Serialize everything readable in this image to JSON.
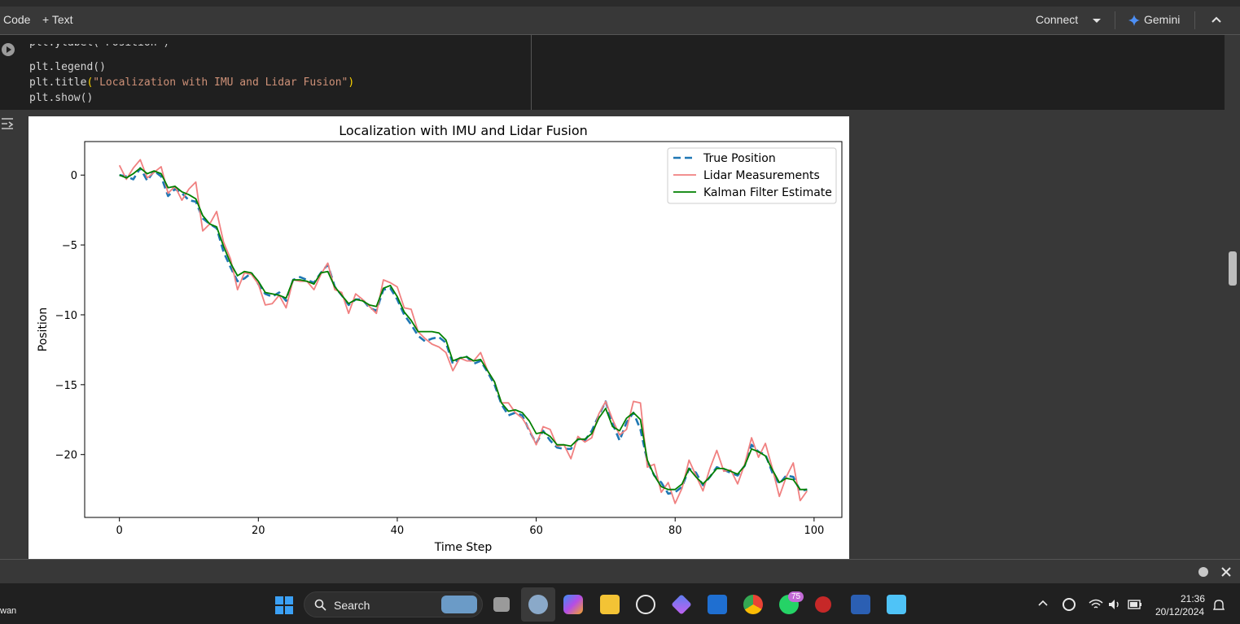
{
  "toolbar": {
    "code_label": "Code",
    "text_label": "+ Text",
    "connect_label": "Connect",
    "gemini_label": "Gemini"
  },
  "cell": {
    "lines": [
      "plt.ylabel(\"Position\")",
      "plt.legend()",
      "plt.title(\"Localization with IMU and Lidar Fusion\")",
      "plt.show()"
    ]
  },
  "chart_data": {
    "type": "line",
    "title": "Localization with IMU and Lidar Fusion",
    "xlabel": "Time Step",
    "ylabel": "Position",
    "xlim": [
      -5,
      104
    ],
    "ylim": [
      -24.5,
      2.4
    ],
    "xticks": [
      0,
      20,
      40,
      60,
      80,
      100
    ],
    "yticks": [
      0,
      -5,
      -10,
      -15,
      -20
    ],
    "legend": "top-right",
    "grid": false,
    "series": [
      {
        "name": "True Position",
        "style": "dashed",
        "color": "#1f77b4",
        "values": [
          0.0,
          -0.1,
          -0.3,
          0.5,
          -0.4,
          0.3,
          -0.1,
          -1.5,
          -1.0,
          -1.3,
          -1.8,
          -1.9,
          -3.1,
          -3.5,
          -3.8,
          -5.5,
          -6.6,
          -7.6,
          -7.4,
          -7.0,
          -7.8,
          -8.5,
          -8.7,
          -8.4,
          -9.0,
          -7.5,
          -7.3,
          -7.5,
          -7.7,
          -7.0,
          -6.4,
          -8.0,
          -8.6,
          -9.3,
          -8.9,
          -8.9,
          -9.5,
          -9.7,
          -8.2,
          -8.1,
          -8.9,
          -10.0,
          -10.7,
          -11.5,
          -11.9,
          -11.7,
          -11.6,
          -12.0,
          -13.5,
          -13.1,
          -13.0,
          -13.5,
          -13.3,
          -14.1,
          -15.0,
          -16.4,
          -17.2,
          -17.0,
          -17.2,
          -18.3,
          -19.2,
          -18.3,
          -19.0,
          -19.5,
          -19.6,
          -19.6,
          -18.9,
          -19.0,
          -18.3,
          -17.2,
          -16.2,
          -17.8,
          -19.0,
          -17.7,
          -17.0,
          -18.2,
          -20.5,
          -21.5,
          -22.0,
          -22.8,
          -22.7,
          -22.3,
          -21.0,
          -21.3,
          -22.2,
          -21.6,
          -20.9,
          -21.1,
          -21.3,
          -21.5,
          -20.8,
          -19.3,
          -19.8,
          -20.0,
          -21.3,
          -22.1,
          -21.5,
          -21.6,
          -22.6,
          -22.5
        ]
      },
      {
        "name": "Lidar Measurements",
        "style": "solid",
        "color": "#f08080",
        "values": [
          0.7,
          -0.3,
          0.5,
          1.1,
          -0.2,
          0.2,
          0.6,
          -1.3,
          -0.8,
          -1.8,
          -1.0,
          -0.5,
          -4.0,
          -3.5,
          -2.6,
          -4.8,
          -6.0,
          -8.2,
          -7.0,
          -7.1,
          -7.8,
          -9.3,
          -9.2,
          -8.6,
          -9.5,
          -7.5,
          -7.6,
          -7.6,
          -8.2,
          -7.1,
          -6.3,
          -8.2,
          -8.4,
          -9.9,
          -8.5,
          -8.9,
          -9.4,
          -9.9,
          -7.5,
          -7.7,
          -8.0,
          -9.5,
          -9.6,
          -11.2,
          -11.7,
          -12.1,
          -12.3,
          -12.7,
          -14.0,
          -13.1,
          -13.3,
          -13.3,
          -12.7,
          -14.0,
          -14.8,
          -16.3,
          -16.3,
          -17.0,
          -17.4,
          -18.2,
          -19.3,
          -18.0,
          -18.2,
          -19.4,
          -19.3,
          -20.3,
          -18.7,
          -19.1,
          -18.8,
          -17.1,
          -16.2,
          -17.5,
          -18.6,
          -18.2,
          -16.2,
          -16.3,
          -20.9,
          -20.7,
          -22.7,
          -22.0,
          -23.5,
          -22.4,
          -20.4,
          -21.5,
          -22.6,
          -21.0,
          -19.7,
          -21.2,
          -21.1,
          -22.1,
          -20.7,
          -18.8,
          -20.2,
          -19.2,
          -21.0,
          -23.0,
          -21.6,
          -20.6,
          -23.3,
          -22.6
        ]
      },
      {
        "name": "Kalman Filter Estimate",
        "style": "solid",
        "color": "#008000",
        "values": [
          0.0,
          -0.2,
          0.1,
          0.5,
          0.1,
          0.3,
          0.1,
          -0.9,
          -0.8,
          -1.2,
          -1.4,
          -1.7,
          -2.9,
          -3.5,
          -3.7,
          -5.1,
          -6.3,
          -7.2,
          -6.9,
          -7.0,
          -7.6,
          -8.4,
          -8.5,
          -8.6,
          -8.8,
          -7.5,
          -7.5,
          -7.6,
          -7.8,
          -7.0,
          -6.9,
          -8.0,
          -8.6,
          -9.2,
          -8.9,
          -9.0,
          -9.3,
          -9.4,
          -8.1,
          -7.9,
          -8.7,
          -9.8,
          -10.4,
          -11.2,
          -11.2,
          -11.2,
          -11.3,
          -11.8,
          -13.3,
          -13.1,
          -13.0,
          -13.3,
          -13.2,
          -14.0,
          -14.8,
          -16.3,
          -16.9,
          -16.8,
          -17.0,
          -17.6,
          -18.5,
          -18.4,
          -18.7,
          -19.3,
          -19.3,
          -19.4,
          -18.9,
          -18.9,
          -18.5,
          -17.4,
          -16.7,
          -18.0,
          -18.3,
          -17.4,
          -17.0,
          -17.5,
          -20.4,
          -21.5,
          -22.3,
          -22.5,
          -22.5,
          -22.1,
          -21.0,
          -21.6,
          -22.1,
          -21.6,
          -21.0,
          -21.0,
          -21.2,
          -21.4,
          -20.8,
          -19.6,
          -19.8,
          -20.1,
          -21.1,
          -22.0,
          -21.7,
          -21.8,
          -22.5,
          -22.5
        ]
      }
    ]
  },
  "statusbar": {
    "username_fragment": "wan"
  },
  "taskbar": {
    "search_label": "Search",
    "whatsapp_badge": "75",
    "time": "21:36",
    "date": "20/12/2024"
  }
}
